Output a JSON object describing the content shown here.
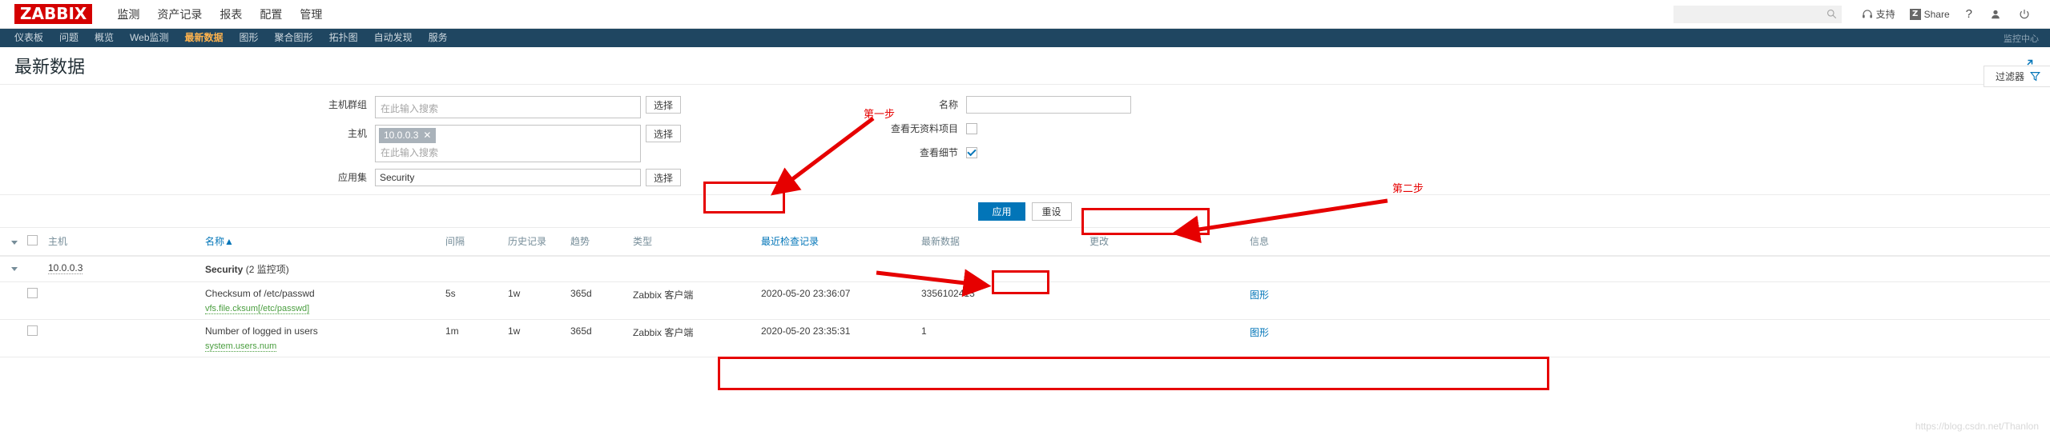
{
  "header": {
    "logo": "ZABBIX",
    "main_nav": [
      {
        "label": "监测",
        "active": true
      },
      {
        "label": "资产记录",
        "active": false
      },
      {
        "label": "报表",
        "active": false
      },
      {
        "label": "配置",
        "active": false
      },
      {
        "label": "管理",
        "active": false
      }
    ],
    "search_placeholder": "",
    "search_value": "",
    "support_label": "支持",
    "share_label": "Share",
    "share_badge": "Z",
    "help_label": "?",
    "icons": {
      "search": "search-icon",
      "support": "headset-icon",
      "share": "zabbix-share-icon",
      "help": "question-mark-icon",
      "user": "user-profile-icon",
      "logout": "power-icon"
    }
  },
  "sub_nav": {
    "items": [
      {
        "label": "仪表板",
        "active": false
      },
      {
        "label": "问题",
        "active": false
      },
      {
        "label": "概览",
        "active": false
      },
      {
        "label": "Web监测",
        "active": false
      },
      {
        "label": "最新数据",
        "active": true
      },
      {
        "label": "图形",
        "active": false
      },
      {
        "label": "聚合图形",
        "active": false
      },
      {
        "label": "拓扑图",
        "active": false
      },
      {
        "label": "自动发现",
        "active": false
      },
      {
        "label": "服务",
        "active": false
      }
    ],
    "right_label": "监控中心"
  },
  "page": {
    "title": "最新数据",
    "kiosk_icon": "expand-arrows-icon",
    "filter_tab_label": "过滤器",
    "filter_tab_icon": "filter-funnel-icon"
  },
  "filter": {
    "host_group": {
      "label": "主机群组",
      "value": "",
      "placeholder": "在此输入搜索",
      "select_button": "选择"
    },
    "host": {
      "label": "主机",
      "chip": "10.0.0.3",
      "chip_remove": "✕",
      "placeholder": "在此输入搜索",
      "select_button": "选择"
    },
    "application": {
      "label": "应用集",
      "value": "Security",
      "placeholder": "",
      "select_button": "选择"
    },
    "name": {
      "label": "名称",
      "value": "",
      "placeholder": ""
    },
    "show_without_data": {
      "label": "查看无资料项目",
      "checked": false
    },
    "show_details": {
      "label": "查看细节",
      "checked": true
    },
    "apply_button": "应用",
    "reset_button": "重设"
  },
  "annotations": {
    "step_one": "第一步",
    "step_two": "第二步",
    "accent_color": "#e60000"
  },
  "table": {
    "headers": [
      {
        "label": "主机",
        "sortable": false
      },
      {
        "label": "名称▲",
        "sortable": true
      },
      {
        "label": "间隔",
        "sortable": false
      },
      {
        "label": "历史记录",
        "sortable": false
      },
      {
        "label": "趋势",
        "sortable": false
      },
      {
        "label": "类型",
        "sortable": false
      },
      {
        "label": "最近检查记录",
        "sortable": true
      },
      {
        "label": "最新数据",
        "sortable": false
      },
      {
        "label": "更改",
        "sortable": false
      },
      {
        "label": "信息",
        "sortable": false
      }
    ],
    "group_row": {
      "host": "10.0.0.3",
      "name": "Security",
      "count": "(2 监控项)"
    },
    "rows": [
      {
        "host": "",
        "name": "Checksum of /etc/passwd",
        "key": "vfs.file.cksum[/etc/passwd]",
        "interval": "5s",
        "history": "1w",
        "trend": "365d",
        "type": "Zabbix 客户端",
        "last_check": "2020-05-20 23:36:07",
        "last_data": "3356102413",
        "change": "",
        "info": "",
        "graph_link": "图形",
        "highlighted": true
      },
      {
        "host": "",
        "name": "Number of logged in users",
        "key": "system.users.num",
        "interval": "1m",
        "history": "1w",
        "trend": "365d",
        "type": "Zabbix 客户端",
        "last_check": "2020-05-20 23:35:31",
        "last_data": "1",
        "change": "",
        "info": "",
        "graph_link": "图形",
        "highlighted": false
      }
    ]
  },
  "watermark": "https://blog.csdn.net/Thanlon"
}
